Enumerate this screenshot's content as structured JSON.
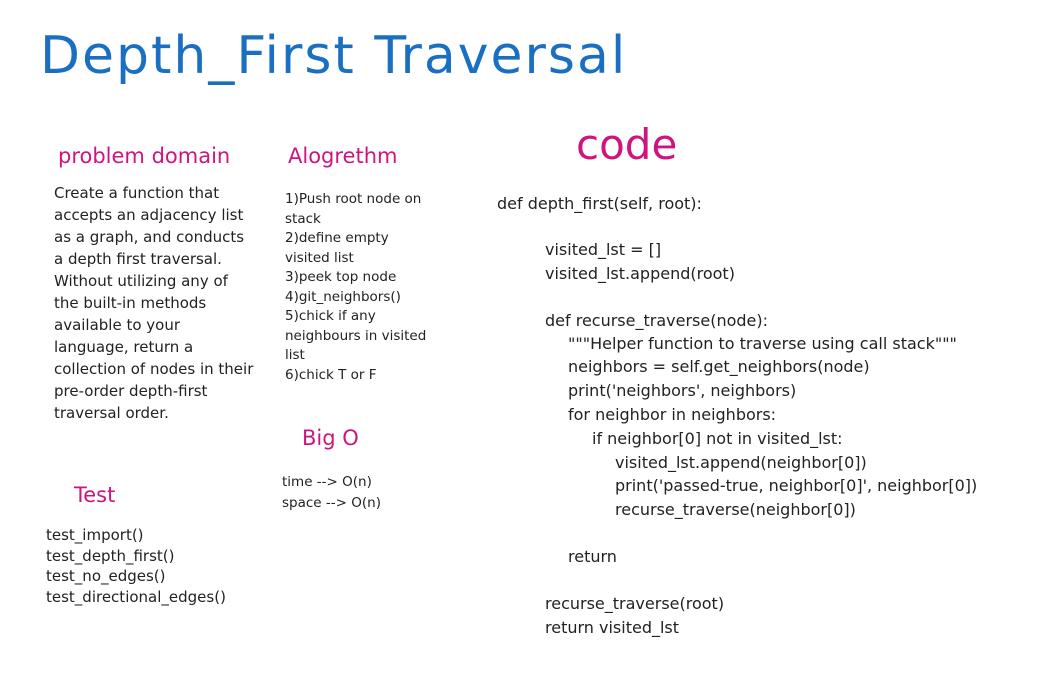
{
  "title": "Depth_First Traversal",
  "problem_domain": {
    "heading": "problem domain",
    "lines": [
      "Create a function that",
      "accepts an adjacency list",
      "as a graph, and conducts",
      "a depth first traversal.",
      "Without utilizing any of",
      "the built-in methods",
      "available to your",
      "language, return a",
      "collection of nodes in their",
      "pre-order depth-first",
      "traversal order."
    ]
  },
  "algorithm": {
    "heading": "Alogrethm",
    "lines": [
      "1)Push root node on",
      "stack",
      "2)define empty",
      "visited list",
      "3)peek top node",
      "4)git_neighbors()",
      "5)chick if any",
      "neighbours in visited",
      "list",
      "6)chick T or F"
    ]
  },
  "big_o": {
    "heading": "Big O",
    "lines": [
      "time --> O(n)",
      "space --> O(n)"
    ]
  },
  "test": {
    "heading": "Test",
    "lines": [
      "test_import()",
      "test_depth_first()",
      "test_no_edges()",
      "test_directional_edges()"
    ]
  },
  "code": {
    "heading": "code",
    "line_01": "def depth_first(self, root):",
    "line_02": "visited_lst = []",
    "line_03": "visited_lst.append(root)",
    "line_04": "def recurse_traverse(node):",
    "line_05": "\"\"\"Helper function to traverse using call stack\"\"\"",
    "line_06": "neighbors = self.get_neighbors(node)",
    "line_07": "print('neighbors', neighbors)",
    "line_08": "for neighbor in neighbors:",
    "line_09": "if neighbor[0] not in visited_lst:",
    "line_10": "visited_lst.append(neighbor[0])",
    "line_11": "print('passed-true, neighbor[0]', neighbor[0])",
    "line_12": "recurse_traverse(neighbor[0])",
    "line_13": "return",
    "line_14": "recurse_traverse(root)",
    "line_15": "return visited_lst"
  },
  "colors": {
    "title": "#1a6fc2",
    "heading": "#d0147f",
    "text": "#222222"
  }
}
